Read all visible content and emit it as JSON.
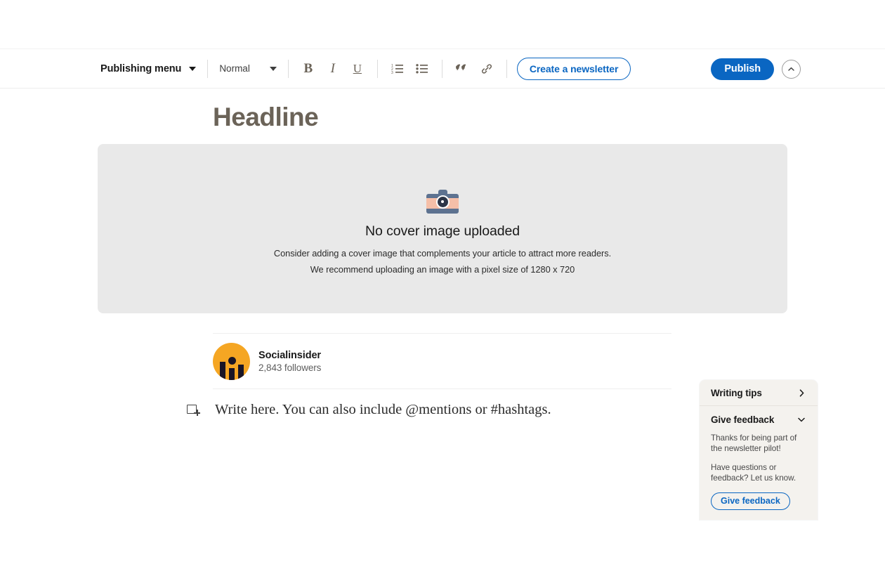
{
  "toolbar": {
    "publishing_menu_label": "Publishing menu",
    "style_label": "Normal",
    "bold_label": "B",
    "italic_label": "I",
    "underline_label": "U",
    "quote_label": "””",
    "newsletter_button_label": "Create a newsletter",
    "publish_button_label": "Publish",
    "icons": {
      "caret": "chevron-down-icon",
      "ordered_list": "ordered-list-icon",
      "bulleted_list": "bulleted-list-icon",
      "quote": "quote-icon",
      "link": "link-icon",
      "collapse": "chevron-up-icon"
    },
    "accent_color": "#0a66c2",
    "icon_color": "#6a6257"
  },
  "editor": {
    "headline_placeholder": "Headline",
    "cover": {
      "icon": "camera-icon",
      "title": "No cover image uploaded",
      "line1": "Consider adding a cover image that complements your article to attract more readers.",
      "line2": "We recommend uploading an image with a pixel size of 1280 x 720",
      "background_color": "#e9e9e9"
    },
    "author": {
      "avatar_icon": "socialinsider-logo-icon",
      "avatar_color": "#f5a623",
      "name": "Socialinsider",
      "followers": "2,843 followers"
    },
    "body": {
      "insert_icon": "insert-content-icon",
      "placeholder": "Write here. You can also include @mentions or #hashtags."
    }
  },
  "tips_panel": {
    "writing_tips": {
      "title": "Writing tips",
      "chevron_icon": "chevron-right-icon"
    },
    "give_feedback": {
      "title": "Give feedback",
      "chevron_icon": "chevron-down-icon",
      "paragraph1": "Thanks for being part of the newsletter pilot!",
      "paragraph2": "Have questions or feedback? Let us know.",
      "button_label": "Give feedback"
    },
    "background_color": "#f4f2ee"
  }
}
